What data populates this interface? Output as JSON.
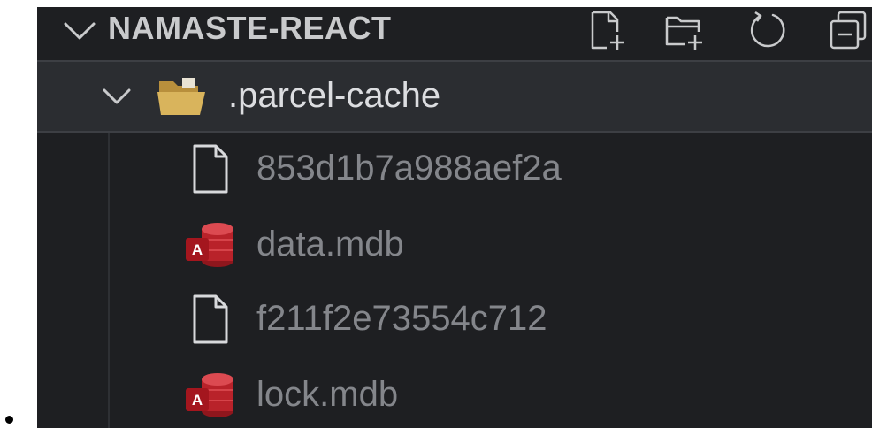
{
  "explorer": {
    "section_title": "NAMASTE-REACT",
    "actions": [
      {
        "icon": "new-file-icon"
      },
      {
        "icon": "new-folder-icon"
      },
      {
        "icon": "refresh-icon"
      },
      {
        "icon": "collapse-all-icon"
      }
    ],
    "folder": {
      "label": ".parcel-cache",
      "icon": "folder-open-icon",
      "expanded": true
    },
    "files": [
      {
        "label": "853d1b7a988aef2a",
        "icon": "generic-file-icon"
      },
      {
        "label": "data.mdb",
        "icon": "access-database-icon"
      },
      {
        "label": "f211f2e73554c712",
        "icon": "generic-file-icon"
      },
      {
        "label": "lock.mdb",
        "icon": "access-database-icon"
      }
    ]
  },
  "colors": {
    "panel_background": "#1e1f22",
    "selected_row_background": "#2b2d31",
    "folder_yellow": "#d9b45c",
    "access_red": "#b9222a",
    "file_text_dim": "#84868b",
    "title_text": "#c9cacc"
  }
}
